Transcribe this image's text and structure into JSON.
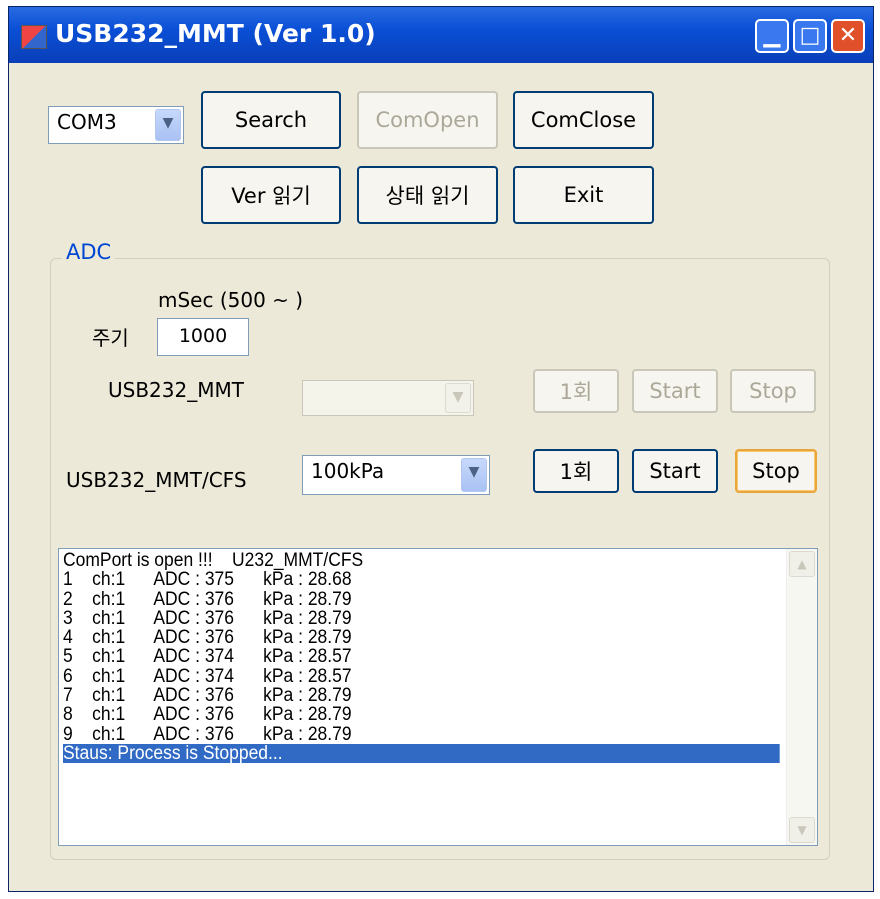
{
  "window": {
    "title": "USB232_MMT (Ver 1.0)"
  },
  "titlebar_buttons": {
    "minimize": "▁",
    "maximize": "□",
    "close": "✕"
  },
  "toolbar": {
    "port_value": "COM3",
    "search_label": "Search",
    "comopen_label": "ComOpen",
    "comclose_label": "ComClose",
    "ver_read_label": "Ver 읽기",
    "status_read_label": "상태 읽기",
    "exit_label": "Exit"
  },
  "adc": {
    "group_title": "ADC",
    "msec_hint": "mSec (500 ~ )",
    "period_label": "주기",
    "period_value": "1000",
    "mmt": {
      "label": "USB232_MMT",
      "select_value": "",
      "once_label": "1회",
      "start_label": "Start",
      "stop_label": "Stop"
    },
    "cfs": {
      "label": "USB232_MMT/CFS",
      "select_value": "100kPa",
      "once_label": "1회",
      "start_label": "Start",
      "stop_label": "Stop"
    }
  },
  "log": {
    "lines": [
      "ComPort is open !!!    U232_MMT/CFS",
      "1    ch:1      ADC : 375      kPa : 28.68",
      "2    ch:1      ADC : 376      kPa : 28.79",
      "3    ch:1      ADC : 376      kPa : 28.79",
      "4    ch:1      ADC : 376      kPa : 28.79",
      "5    ch:1      ADC : 374      kPa : 28.57",
      "6    ch:1      ADC : 374      kPa : 28.57",
      "7    ch:1      ADC : 376      kPa : 28.79",
      "8    ch:1      ADC : 376      kPa : 28.79",
      "9    ch:1      ADC : 376      kPa : 28.79",
      "Staus: Process is Stopped..."
    ],
    "selected_index": 10
  },
  "icons": {
    "dropdown": "chevron-down-icon",
    "scroll_up": "chevron-up-icon",
    "scroll_down": "chevron-down-icon"
  },
  "colors": {
    "titlebar": "#0a4fd6",
    "selection": "#316ac5",
    "groupbox_title": "#0046d5",
    "focused_border": "#e8a53a"
  }
}
